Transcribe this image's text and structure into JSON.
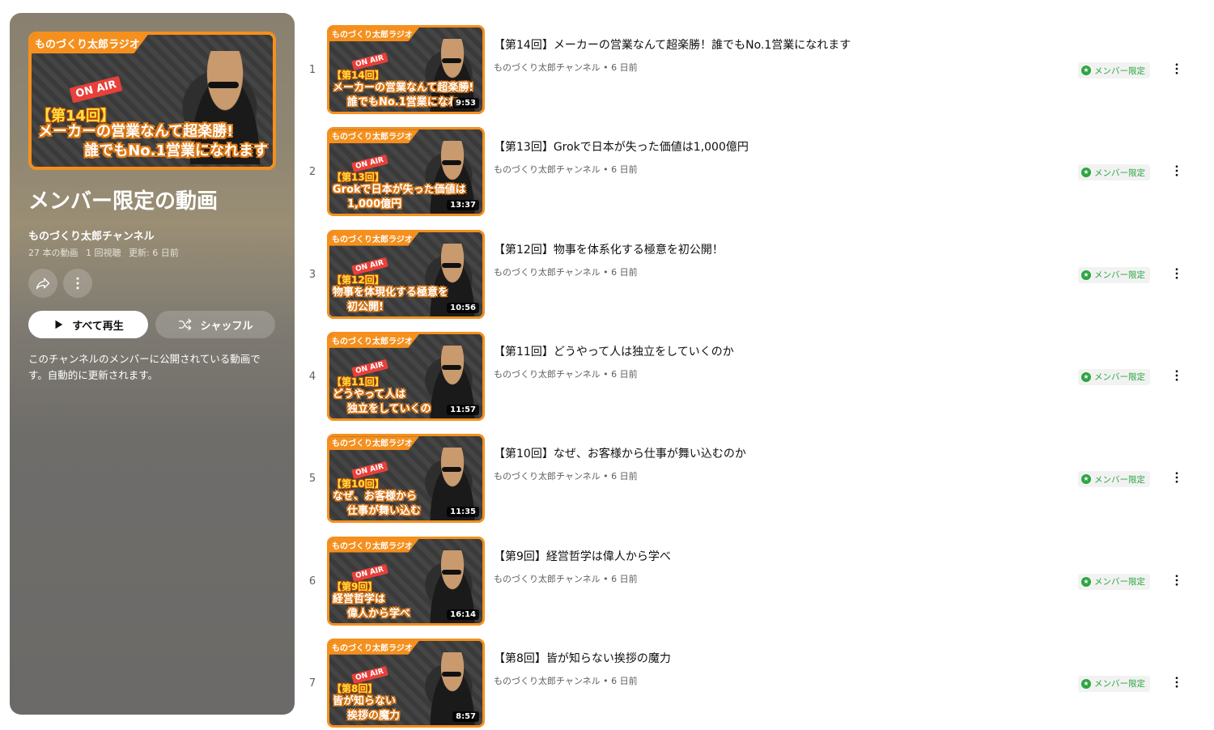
{
  "playlist": {
    "hero": {
      "top_label": "ものづくり太郎ラジオ",
      "onair": "ON AIR",
      "ep_tag": "【第14回】",
      "caption_line1": "メーカーの営業なんて超楽勝!",
      "caption_line2": "誰でもNo.1営業になれます"
    },
    "title": "メンバー限定の動画",
    "channel": "ものづくり太郎チャンネル",
    "video_count": "27 本の動画",
    "views": "1 回視聴",
    "updated": "更新: 6 日前",
    "play_all_label": "すべて再生",
    "shuffle_label": "シャッフル",
    "description": "このチャンネルのメンバーに公開されている動画です。自動的に更新されます。"
  },
  "badge_label": "メンバー限定",
  "videos": [
    {
      "index": "1",
      "title": "【第14回】メーカーの営業なんて超楽勝！誰でもNo.1営業になれます",
      "channel": "ものづくり太郎チャンネル",
      "age": "6 日前",
      "duration": "9:53",
      "thumb_top": "ものづくり太郎ラジオ",
      "thumb_ep": "【第14回】",
      "thumb_line1": "メーカーの営業なんて超楽勝!",
      "thumb_line2": "誰でもNo.1営業になれ"
    },
    {
      "index": "2",
      "title": "【第13回】Grokで日本が失った価値は1,000億円",
      "channel": "ものづくり太郎チャンネル",
      "age": "6 日前",
      "duration": "13:37",
      "thumb_top": "ものづくり太郎ラジオ",
      "thumb_ep": "【第13回】",
      "thumb_line1": "Grokで日本が失った価値は",
      "thumb_line2": "1,000億円"
    },
    {
      "index": "3",
      "title": "【第12回】物事を体系化する極意を初公開！",
      "channel": "ものづくり太郎チャンネル",
      "age": "6 日前",
      "duration": "10:56",
      "thumb_top": "ものづくり太郎ラジオ",
      "thumb_ep": "【第12回】",
      "thumb_line1": "物事を体現化する極意を",
      "thumb_line2": "初公開!"
    },
    {
      "index": "4",
      "title": "【第11回】どうやって人は独立をしていくのか",
      "channel": "ものづくり太郎チャンネル",
      "age": "6 日前",
      "duration": "11:57",
      "thumb_top": "ものづくり太郎ラジオ",
      "thumb_ep": "【第11回】",
      "thumb_line1": "どうやって人は",
      "thumb_line2": "独立をしていくの"
    },
    {
      "index": "5",
      "title": "【第10回】なぜ、お客様から仕事が舞い込むのか",
      "channel": "ものづくり太郎チャンネル",
      "age": "6 日前",
      "duration": "11:35",
      "thumb_top": "ものづくり太郎ラジオ",
      "thumb_ep": "【第10回】",
      "thumb_line1": "なぜ、お客様から",
      "thumb_line2": "仕事が舞い込む"
    },
    {
      "index": "6",
      "title": "【第9回】経営哲学は偉人から学べ",
      "channel": "ものづくり太郎チャンネル",
      "age": "6 日前",
      "duration": "16:14",
      "thumb_top": "ものづくり太郎ラジオ",
      "thumb_ep": "【第9回】",
      "thumb_line1": "経営哲学は",
      "thumb_line2": "偉人から学べ"
    },
    {
      "index": "7",
      "title": "【第8回】皆が知らない挨拶の魔力",
      "channel": "ものづくり太郎チャンネル",
      "age": "6 日前",
      "duration": "8:57",
      "thumb_top": "ものづくり太郎ラジオ",
      "thumb_ep": "【第8回】",
      "thumb_line1": "皆が知らない",
      "thumb_line2": "挨拶の魔力"
    }
  ],
  "icons": {
    "share": "share-icon",
    "more": "more-vert-icon",
    "play": "play-icon",
    "shuffle": "shuffle-icon",
    "member": "member-star-icon"
  },
  "colors": {
    "accent_orange": "#f5901e",
    "member_green": "#2ba640"
  }
}
